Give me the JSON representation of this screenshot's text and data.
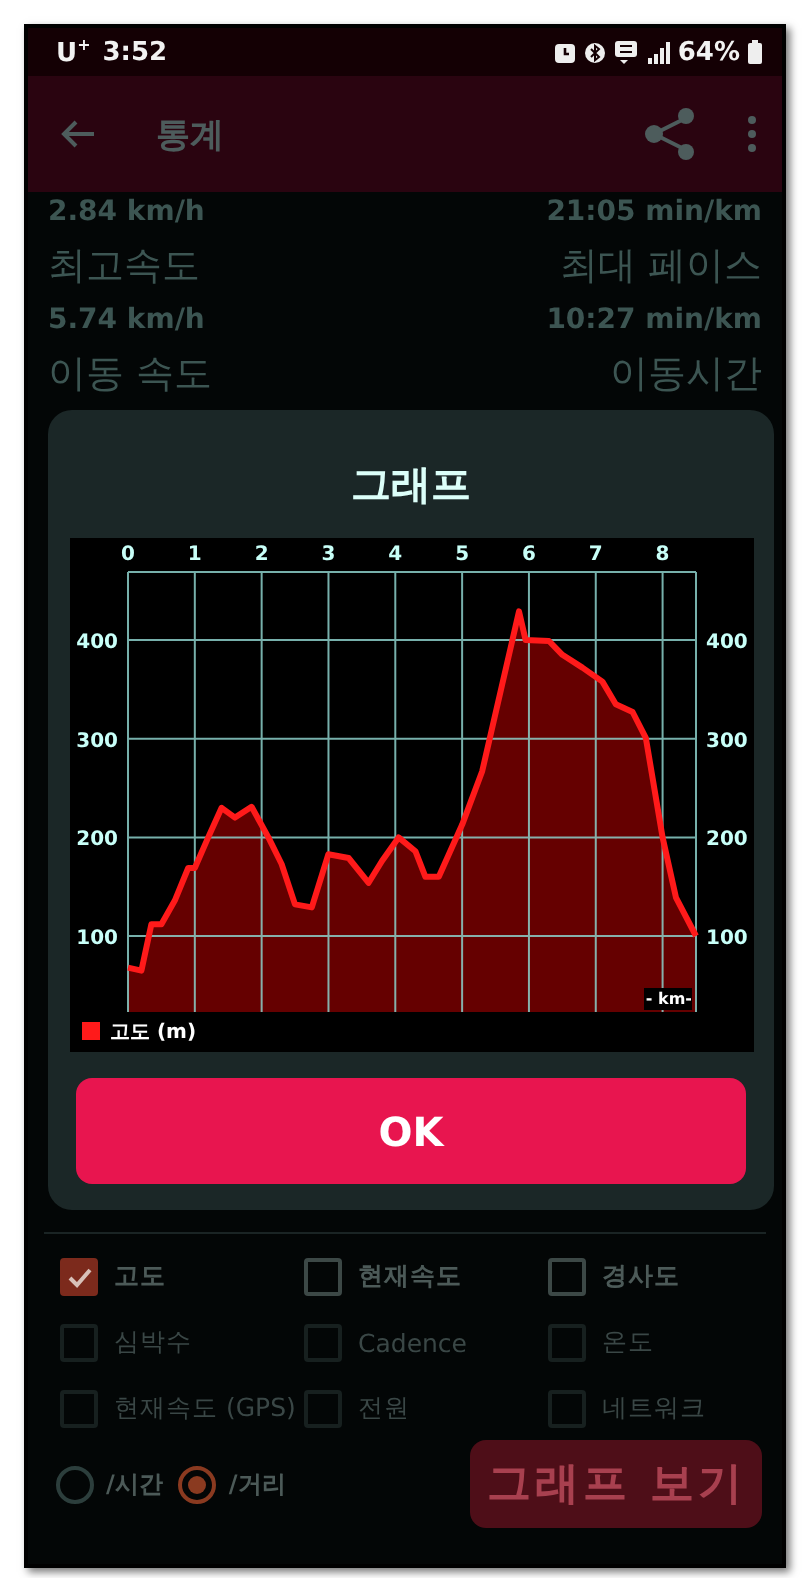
{
  "status_bar": {
    "carrier": "U$^{+}$",
    "time": "3:52",
    "battery": "64%"
  },
  "app_bar": {
    "title": "통계"
  },
  "stats": [
    {
      "left": "2.84 km/h",
      "right": "21:05 min/km",
      "kind": "value"
    },
    {
      "left": "최고속도",
      "right": "최대 페이스",
      "kind": "label"
    },
    {
      "left": "5.74 km/h",
      "right": "10:27 min/km",
      "kind": "value"
    },
    {
      "left": "이동 속도",
      "right": "이동시간",
      "kind": "label"
    }
  ],
  "dialog": {
    "title": "그래프",
    "button": "OK",
    "chart_data": {
      "type": "area",
      "xlabel": "- km-",
      "x": [
        0,
        0.2,
        0.35,
        0.5,
        0.7,
        0.9,
        1.0,
        1.2,
        1.4,
        1.6,
        1.85,
        2.1,
        2.3,
        2.5,
        2.75,
        3.0,
        3.3,
        3.6,
        3.8,
        4.05,
        4.3,
        4.45,
        4.65,
        5.0,
        5.3,
        5.6,
        5.85,
        5.95,
        6.3,
        6.5,
        6.8,
        7.1,
        7.3,
        7.55,
        7.75,
        8.0,
        8.2,
        8.5
      ],
      "series": [
        {
          "name": "고도 (m)",
          "color": "#ff1a1a",
          "values": [
            68,
            65,
            112,
            112,
            136,
            169,
            169,
            200,
            230,
            220,
            231,
            200,
            173,
            132,
            129,
            183,
            179,
            154,
            176,
            200,
            186,
            160,
            160,
            213,
            267,
            355,
            429,
            400,
            399,
            385,
            372,
            358,
            335,
            327,
            301,
            200,
            139,
            100
          ]
        }
      ],
      "xlim": [
        0,
        8.5
      ],
      "ylim": [
        23,
        469
      ],
      "xticks": [
        0,
        1,
        2,
        3,
        4,
        5,
        6,
        7,
        8
      ],
      "yticks": [
        100,
        200,
        300,
        400
      ],
      "annotations": [
        "100",
        "200",
        "300",
        "400"
      ],
      "grid": true
    }
  },
  "options": [
    {
      "label": "고도",
      "checked": true,
      "disabled": false
    },
    {
      "label": "현재속도",
      "checked": false,
      "disabled": false
    },
    {
      "label": "경사도",
      "checked": false,
      "disabled": false
    },
    {
      "label": "심박수",
      "checked": false,
      "disabled": true
    },
    {
      "label": "Cadence",
      "checked": false,
      "disabled": true
    },
    {
      "label": "온도",
      "checked": false,
      "disabled": true
    },
    {
      "label": "현재속도 (GPS)",
      "checked": false,
      "disabled": true
    },
    {
      "label": "전원",
      "checked": false,
      "disabled": true
    },
    {
      "label": "네트워크",
      "checked": false,
      "disabled": true
    }
  ],
  "axis_modes": [
    {
      "label": "/시간",
      "selected": false
    },
    {
      "label": "/거리",
      "selected": true
    }
  ],
  "graph_button": "그래프 보기"
}
